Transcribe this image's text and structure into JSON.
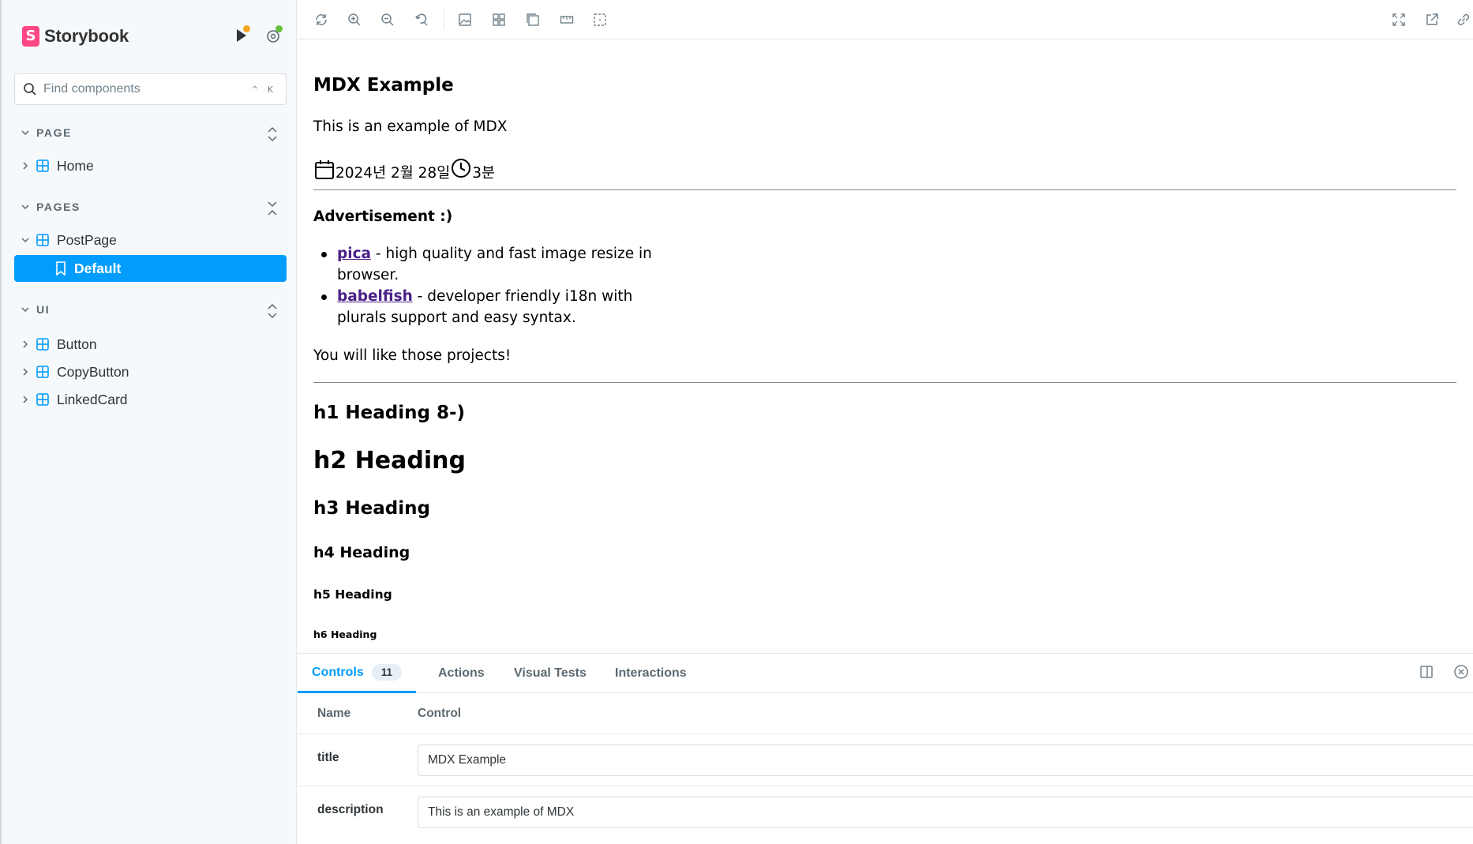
{
  "sidebar": {
    "brand_logo_letter": "S",
    "brand_name": "Storybook",
    "search": {
      "placeholder": "Find components",
      "shortcut": "^ K"
    },
    "sections": [
      {
        "label": "PAGE",
        "items": [
          {
            "label": "Home"
          }
        ]
      },
      {
        "label": "PAGES",
        "items": [
          {
            "label": "PostPage",
            "stories": [
              {
                "label": "Default",
                "selected": true
              }
            ]
          }
        ]
      },
      {
        "label": "UI",
        "items": [
          {
            "label": "Button"
          },
          {
            "label": "CopyButton"
          },
          {
            "label": "LinkedCard"
          }
        ]
      }
    ],
    "colors": {
      "accent": "#029cfd",
      "brand": "#ff4785",
      "component_icon": "#029cfd",
      "notify_dot": "#f5a623",
      "status_dot": "#66bf3c"
    }
  },
  "toolbar": {
    "left_icons": [
      "reload-icon",
      "zoom-in-icon",
      "zoom-out-icon",
      "zoom-reset-icon",
      "background-icon",
      "grid-icon",
      "viewport-icon",
      "measure-icon",
      "outline-icon"
    ],
    "right_icons": [
      "fullscreen-icon",
      "open-new-tab-icon",
      "copy-link-icon"
    ]
  },
  "preview": {
    "title": "MDX Example",
    "description": "This is an example of MDX",
    "date": "2024년 2월 28일",
    "read_time": "3분",
    "ad_title": "Advertisement :)",
    "ads": [
      {
        "link": "pica",
        "text": " - high quality and fast image resize in browser."
      },
      {
        "link": "babelfish",
        "text": " - developer friendly i18n with plurals support and easy syntax."
      }
    ],
    "ad_footer": "You will like those projects!",
    "headings": {
      "h1": "h1 Heading 8-)",
      "h2": "h2 Heading",
      "h3": "h3 Heading",
      "h4": "h4 Heading",
      "h5": "h5 Heading",
      "h6": "h6 Heading"
    }
  },
  "panel": {
    "tabs": [
      {
        "label": "Controls",
        "badge": "11",
        "active": true
      },
      {
        "label": "Actions"
      },
      {
        "label": "Visual Tests"
      },
      {
        "label": "Interactions"
      }
    ],
    "columns": {
      "name": "Name",
      "control": "Control"
    },
    "args": [
      {
        "name": "title",
        "value": "MDX Example"
      },
      {
        "name": "description",
        "value": "This is an example of MDX"
      }
    ]
  }
}
